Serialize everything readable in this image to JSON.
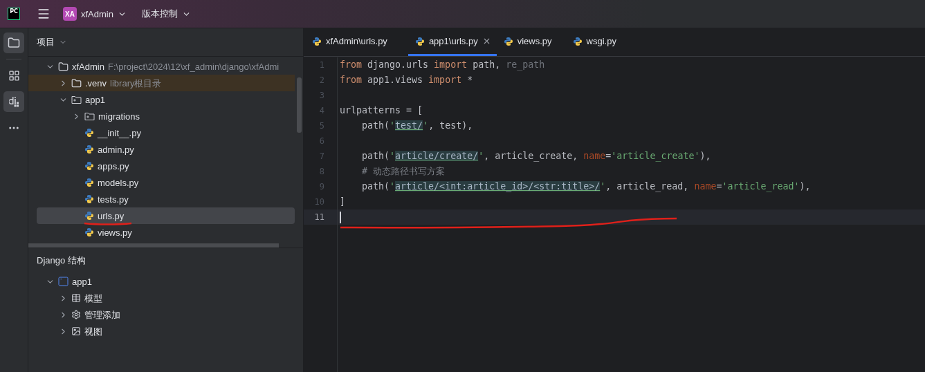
{
  "title_bar": {
    "logo": "PC",
    "project": {
      "badge": "XA",
      "name": "xfAdmin"
    },
    "vcs": "版本控制"
  },
  "tool_strip": [
    {
      "kind": "project",
      "selected": true
    },
    {
      "kind": "structure",
      "selected": false
    },
    {
      "kind": "django",
      "selected": true
    },
    {
      "kind": "more",
      "selected": false
    }
  ],
  "project_panel": {
    "title": "项目",
    "tree": [
      {
        "label": "xfAdmin",
        "hint": "F:\\project\\2024\\12\\xf_admin\\django\\xfAdmi",
        "kind": "folder",
        "expanded": true,
        "selected": false,
        "children": [
          {
            "label": ".venv",
            "hint": "library根目录",
            "kind": "library",
            "expanded": false,
            "selected": false
          },
          {
            "label": "app1",
            "kind": "package",
            "expanded": true,
            "selected": false,
            "children": [
              {
                "label": "migrations",
                "kind": "package",
                "expanded": false,
                "selected": false
              },
              {
                "label": "__init__.py",
                "kind": "python",
                "selected": false
              },
              {
                "label": "admin.py",
                "kind": "python",
                "selected": false
              },
              {
                "label": "apps.py",
                "kind": "python",
                "selected": false
              },
              {
                "label": "models.py",
                "kind": "python",
                "selected": false
              },
              {
                "label": "tests.py",
                "kind": "python",
                "selected": false
              },
              {
                "label": "urls.py",
                "kind": "python",
                "selected": true
              },
              {
                "label": "views.py",
                "kind": "python",
                "selected": false
              }
            ]
          }
        ]
      }
    ]
  },
  "django_panel": {
    "title": "Django 结构",
    "tree": [
      {
        "label": "app1",
        "kind": "module",
        "expanded": true,
        "children": [
          {
            "label": "模型",
            "kind": "table",
            "expanded": false
          },
          {
            "label": "管理添加",
            "kind": "gear",
            "expanded": false
          },
          {
            "label": "视图",
            "kind": "image",
            "expanded": false
          }
        ]
      }
    ]
  },
  "tabs": [
    {
      "label": "xfAdmin\\urls.py",
      "selected": false
    },
    {
      "label": "app1\\urls.py",
      "selected": true
    },
    {
      "label": "views.py",
      "selected": false
    },
    {
      "label": "wsgi.py",
      "selected": false
    }
  ],
  "editor": {
    "lines": [
      {
        "number": "1",
        "current": false,
        "tokens": [
          {
            "kind": "keyword",
            "text": "from"
          },
          {
            "kind": "plain",
            "text": " django.urls "
          },
          {
            "kind": "keyword",
            "text": "import"
          },
          {
            "kind": "plain",
            "text": " path, "
          },
          {
            "kind": "unused",
            "text": "re_path"
          }
        ]
      },
      {
        "number": "2",
        "current": false,
        "tokens": [
          {
            "kind": "keyword",
            "text": "from"
          },
          {
            "kind": "plain",
            "text": " app1.views "
          },
          {
            "kind": "keyword",
            "text": "import"
          },
          {
            "kind": "plain",
            "text": " *"
          }
        ]
      },
      {
        "number": "3",
        "current": false
      },
      {
        "number": "4",
        "current": false,
        "tokens": [
          {
            "kind": "plain",
            "text": "urlpatterns = ["
          }
        ]
      },
      {
        "number": "5",
        "current": false,
        "tokens": [
          {
            "kind": "plain",
            "text": "    path("
          },
          {
            "kind": "string",
            "text": "'"
          },
          {
            "kind": "route",
            "text": "test/"
          },
          {
            "kind": "string",
            "text": "'"
          },
          {
            "kind": "plain",
            "text": ", test),"
          }
        ]
      },
      {
        "number": "6",
        "current": false
      },
      {
        "number": "7",
        "current": false,
        "tokens": [
          {
            "kind": "plain",
            "text": "    path("
          },
          {
            "kind": "string",
            "text": "'"
          },
          {
            "kind": "route",
            "text": "article/create/"
          },
          {
            "kind": "string",
            "text": "'"
          },
          {
            "kind": "plain",
            "text": ", article_create, "
          },
          {
            "kind": "param",
            "text": "name"
          },
          {
            "kind": "plain",
            "text": "="
          },
          {
            "kind": "string",
            "text": "'article_create'"
          },
          {
            "kind": "plain",
            "text": "),"
          }
        ]
      },
      {
        "number": "8",
        "current": false,
        "tokens": [
          {
            "kind": "comment",
            "text": "    # 动态路径书写方案"
          }
        ]
      },
      {
        "number": "9",
        "current": false,
        "tokens": [
          {
            "kind": "plain",
            "text": "    path("
          },
          {
            "kind": "string",
            "text": "'"
          },
          {
            "kind": "route",
            "text": "article/<int:article_id>/<str:title>/"
          },
          {
            "kind": "string",
            "text": "'"
          },
          {
            "kind": "plain",
            "text": ", article_read, "
          },
          {
            "kind": "param",
            "text": "name"
          },
          {
            "kind": "plain",
            "text": "="
          },
          {
            "kind": "string",
            "text": "'article_read'"
          },
          {
            "kind": "plain",
            "text": "),"
          }
        ]
      },
      {
        "number": "10",
        "current": false,
        "tokens": [
          {
            "kind": "plain",
            "text": "]"
          }
        ]
      },
      {
        "number": "11",
        "current": true
      }
    ]
  }
}
